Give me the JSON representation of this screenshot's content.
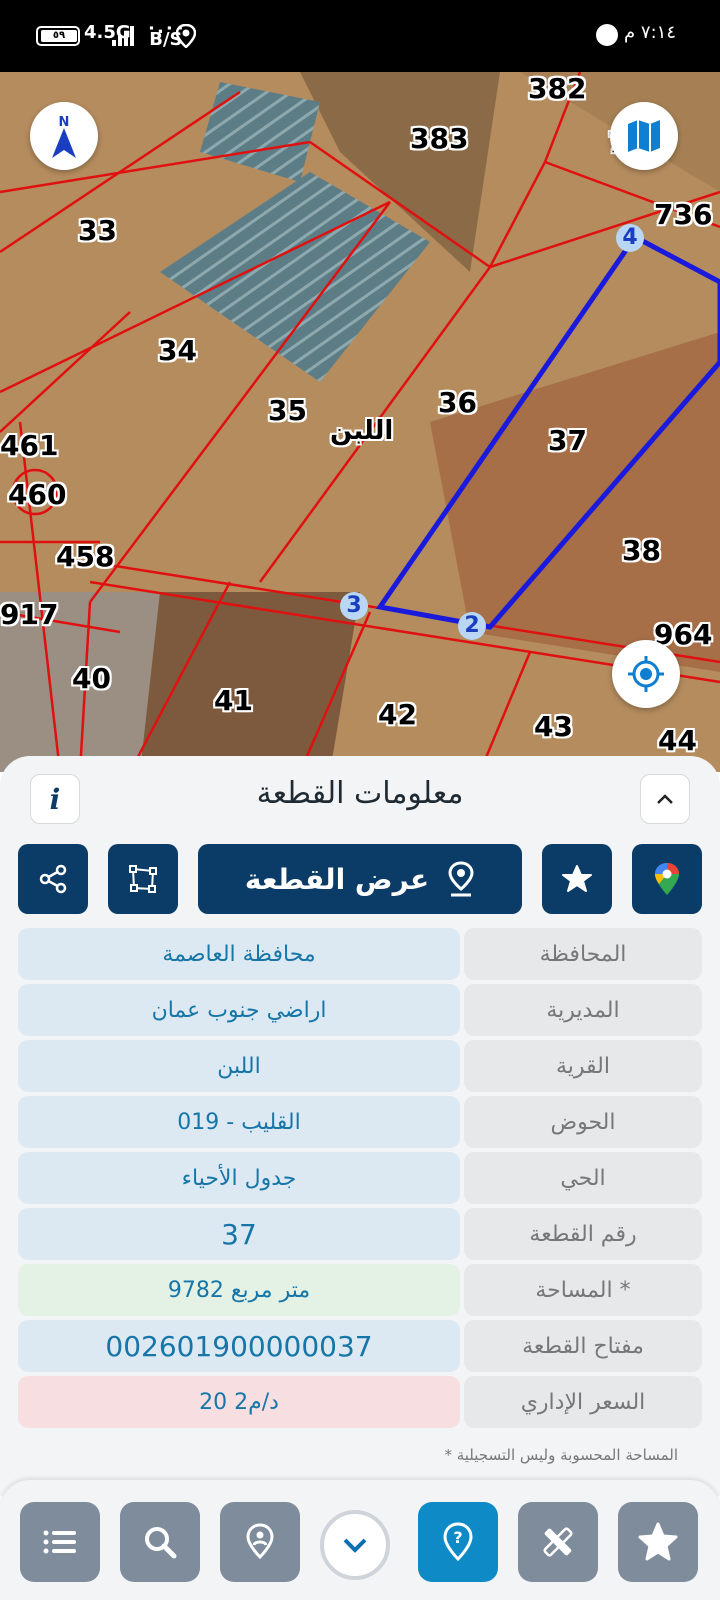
{
  "status_bar": {
    "battery": "٥٩",
    "network": "4.5G",
    "speed_top": "٠.٠٠",
    "speed_unit": "B/S",
    "time": "٧:١٤ م"
  },
  "map": {
    "north_label": "N",
    "village_label": "اللبن",
    "parcels": [
      "382",
      "383",
      "33",
      "34",
      "35",
      "36",
      "37",
      "38",
      "461",
      "460",
      "458",
      "917",
      "40",
      "41",
      "42",
      "43",
      "736",
      "964",
      "44",
      "7"
    ],
    "vertices": [
      "4",
      "3",
      "2"
    ],
    "icons": [
      "compass-icon",
      "map-layers-icon",
      "my-location-icon"
    ],
    "boundary_color": "#1a1adc",
    "parcel_line_color": "#e01010"
  },
  "sheet": {
    "title": "معلومات القطعة",
    "info_label": "i",
    "show_parcel_label": "عرض القطعة",
    "rows": [
      {
        "key": "المحافظة",
        "value": "محافظة العاصمة"
      },
      {
        "key": "المديرية",
        "value": "اراضي جنوب عمان"
      },
      {
        "key": "القرية",
        "value": "اللبن"
      },
      {
        "key": "الحوض",
        "value": "القليب - 019"
      },
      {
        "key": "الحي",
        "value": "جدول الأحياء"
      },
      {
        "key": "رقم القطعة",
        "value": "37"
      },
      {
        "key": "المساحة *",
        "value": "9782   متر مربع"
      },
      {
        "key": "مفتاح القطعة",
        "value": "002601900000037"
      },
      {
        "key": "السعر الإداري",
        "value": "20 د/م2"
      }
    ],
    "footnote": "* المساحة المحسوبة وليس التسجيلية"
  },
  "colors": {
    "primary": "#0b3c67",
    "active_nav": "#0e8bc7",
    "nav_gray": "#7f8c9b"
  }
}
